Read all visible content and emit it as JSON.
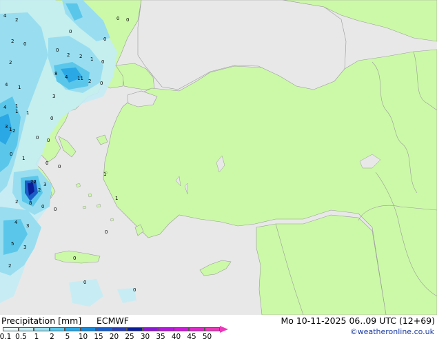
{
  "title": "Precipitation [mm]",
  "model": "ECMWF",
  "datetime": "Mo 10-11-2025 06..09 UTC (12+69)",
  "credit": "©weatheronline.co.uk",
  "colors": {
    "sea": "#e8e8e8",
    "land": "#ccf9a8",
    "border": "#9a9a9a"
  },
  "legend": {
    "labels": [
      "0.1",
      "0.5",
      "1",
      "2",
      "5",
      "10",
      "15",
      "20",
      "25",
      "30",
      "35",
      "40",
      "45",
      "50"
    ],
    "colors": [
      "#e6f6fb",
      "#c4ecf5",
      "#98def0",
      "#5ac7ea",
      "#2aa8e6",
      "#1788d8",
      "#1a5ec8",
      "#2a3eb4",
      "#0c1e96",
      "#8a1ad0",
      "#b01ad8",
      "#cc1ad8",
      "#dc2ac8",
      "#e83ab8"
    ]
  },
  "point_values": [
    "4",
    "2",
    "2",
    "0",
    "0",
    "0",
    "0",
    "0",
    "2",
    "0",
    "2",
    "2",
    "4",
    "1",
    "1",
    "0",
    "1",
    "1",
    "8",
    "4",
    "11",
    "2",
    "0",
    "3",
    "4",
    "1",
    "3",
    "1",
    "2",
    "0",
    "0",
    "0",
    "1",
    "0",
    "0",
    "0",
    "1",
    "22",
    "3",
    "2",
    "8",
    "2",
    "0",
    "0",
    "1",
    "4",
    "3",
    "5",
    "3",
    "2",
    "0",
    "0",
    "0",
    "0"
  ]
}
